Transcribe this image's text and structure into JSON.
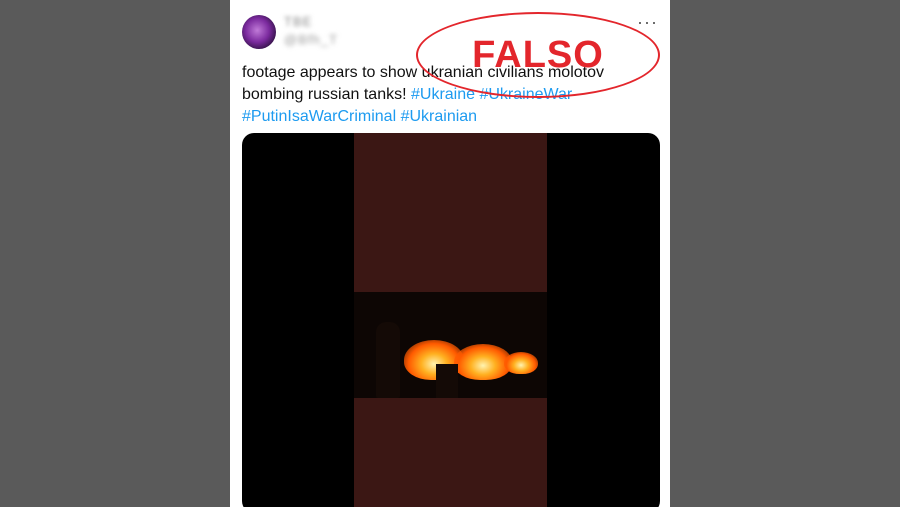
{
  "tweet": {
    "user_name": "TBE",
    "user_handle": "@Bfh_T",
    "more_label": "···",
    "text_parts": [
      {
        "text": "footage appears to show ukranian civilians molotov bombing russian tanks! ",
        "type": "text"
      },
      {
        "text": "#Ukraine",
        "type": "hashtag"
      },
      {
        "text": " ",
        "type": "text"
      },
      {
        "text": "#UkraineWar",
        "type": "hashtag"
      },
      {
        "text": " ",
        "type": "text"
      },
      {
        "text": "#PutinIsaWarCriminal",
        "type": "hashtag"
      },
      {
        "text": " ",
        "type": "text"
      },
      {
        "text": "#Ukrainian",
        "type": "hashtag"
      }
    ]
  },
  "stamp": {
    "label": "FALSO",
    "color": "#e3262c"
  },
  "colors": {
    "hashtag": "#1d9bf0",
    "background": "#5a5a5a"
  }
}
